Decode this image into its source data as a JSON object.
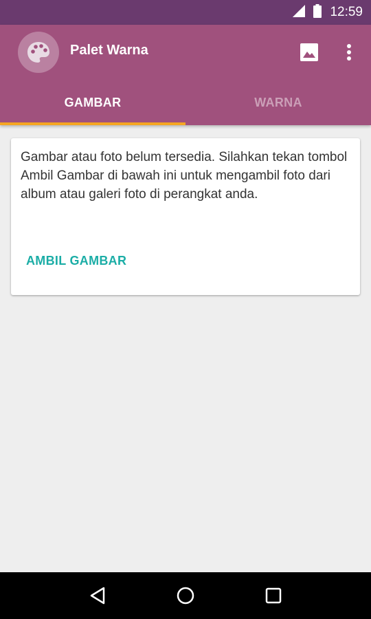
{
  "status_bar": {
    "time": "12:59",
    "signal_icon": "signal-icon",
    "battery_icon": "battery-icon"
  },
  "app_bar": {
    "title": "Palet Warna",
    "logo_icon": "palette-icon",
    "actions": [
      {
        "icon": "image-icon"
      },
      {
        "icon": "more-vert-icon"
      }
    ],
    "color": "#a0517d",
    "status_color": "#6a3a6e"
  },
  "tabs": [
    {
      "label": "GAMBAR",
      "selected": true
    },
    {
      "label": "WARNA",
      "selected": false
    }
  ],
  "tab_indicator_color": "#f5a623",
  "card": {
    "message": "Gambar atau foto belum tersedia. Silahkan tekan tombol Ambil Gambar di bawah ini untuk mengambil foto dari album atau galeri foto di perangkat anda.",
    "button_label": "AMBIL GAMBAR",
    "button_color": "#1bada6"
  },
  "nav_bar": {
    "buttons": [
      {
        "icon": "back-icon"
      },
      {
        "icon": "home-icon"
      },
      {
        "icon": "recents-icon"
      }
    ]
  }
}
